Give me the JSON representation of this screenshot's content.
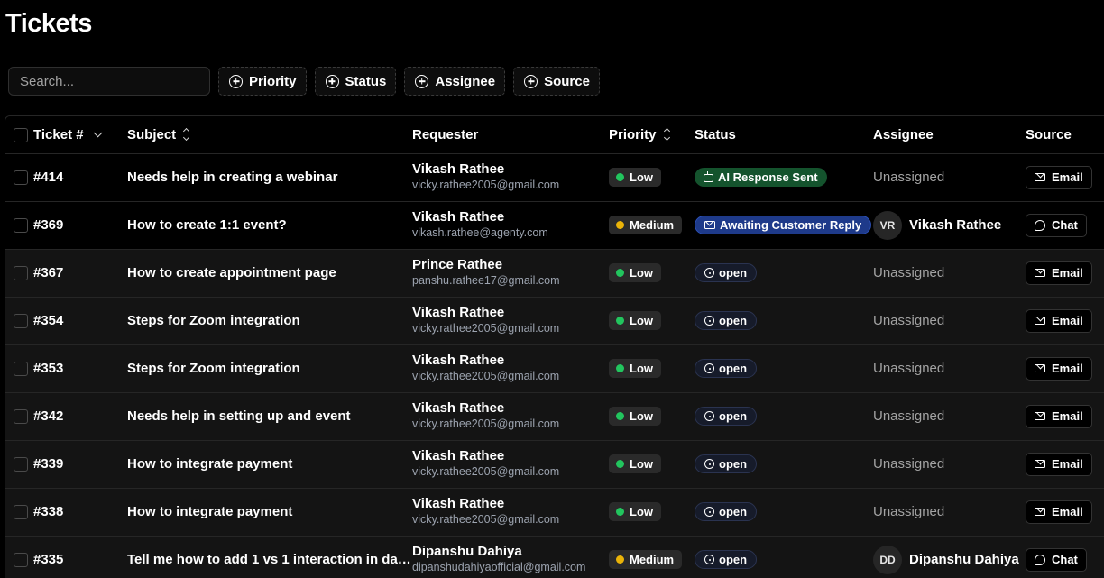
{
  "page": {
    "title": "Tickets"
  },
  "toolbar": {
    "search_placeholder": "Search...",
    "filters": [
      {
        "label": "Priority"
      },
      {
        "label": "Status"
      },
      {
        "label": "Assignee"
      },
      {
        "label": "Source"
      }
    ]
  },
  "table": {
    "headers": {
      "ticket": "Ticket #",
      "subject": "Subject",
      "requester": "Requester",
      "priority": "Priority",
      "status": "Status",
      "assignee": "Assignee",
      "source": "Source"
    },
    "rows": [
      {
        "id": "#414",
        "subject": "Needs help in creating a webinar",
        "requester_name": "Vikash Rathee",
        "requester_email": "vicky.rathee2005@gmail.com",
        "priority": "Low",
        "priority_color": "#22c55e",
        "status": "AI Response Sent",
        "status_kind": "ai",
        "assignee": "Unassigned",
        "assignee_initials": "",
        "source": "Email",
        "source_kind": "email",
        "extra": "S",
        "shade": "dark"
      },
      {
        "id": "#369",
        "subject": "How to create 1:1 event?",
        "requester_name": "Vikash Rathee",
        "requester_email": "vikash.rathee@agenty.com",
        "priority": "Medium",
        "priority_color": "#eab308",
        "status": "Awaiting Customer Reply",
        "status_kind": "await",
        "assignee": "Vikash Rathee",
        "assignee_initials": "VR",
        "source": "Chat",
        "source_kind": "chat",
        "extra": "S",
        "shade": "dark"
      },
      {
        "id": "#367",
        "subject": "How to create appointment page",
        "requester_name": "Prince Rathee",
        "requester_email": "panshu.rathee17@gmail.com",
        "priority": "Low",
        "priority_color": "#22c55e",
        "status": "open",
        "status_kind": "open",
        "assignee": "Unassigned",
        "assignee_initials": "",
        "source": "Email",
        "source_kind": "email",
        "extra": "S",
        "shade": "dim"
      },
      {
        "id": "#354",
        "subject": "Steps for Zoom integration",
        "requester_name": "Vikash Rathee",
        "requester_email": "vicky.rathee2005@gmail.com",
        "priority": "Low",
        "priority_color": "#22c55e",
        "status": "open",
        "status_kind": "open",
        "assignee": "Unassigned",
        "assignee_initials": "",
        "source": "Email",
        "source_kind": "email",
        "extra": "A",
        "shade": "dim"
      },
      {
        "id": "#353",
        "subject": "Steps for Zoom integration",
        "requester_name": "Vikash Rathee",
        "requester_email": "vicky.rathee2005@gmail.com",
        "priority": "Low",
        "priority_color": "#22c55e",
        "status": "open",
        "status_kind": "open",
        "assignee": "Unassigned",
        "assignee_initials": "",
        "source": "Email",
        "source_kind": "email",
        "extra": "A",
        "shade": "dim"
      },
      {
        "id": "#342",
        "subject": "Needs help in setting up and event",
        "requester_name": "Vikash Rathee",
        "requester_email": "vicky.rathee2005@gmail.com",
        "priority": "Low",
        "priority_color": "#22c55e",
        "status": "open",
        "status_kind": "open",
        "assignee": "Unassigned",
        "assignee_initials": "",
        "source": "Email",
        "source_kind": "email",
        "extra": "A",
        "shade": "dim"
      },
      {
        "id": "#339",
        "subject": "How to integrate payment",
        "requester_name": "Vikash Rathee",
        "requester_email": "vicky.rathee2005@gmail.com",
        "priority": "Low",
        "priority_color": "#22c55e",
        "status": "open",
        "status_kind": "open",
        "assignee": "Unassigned",
        "assignee_initials": "",
        "source": "Email",
        "source_kind": "email",
        "extra": "A",
        "shade": "dim"
      },
      {
        "id": "#338",
        "subject": "How to integrate payment",
        "requester_name": "Vikash Rathee",
        "requester_email": "vicky.rathee2005@gmail.com",
        "priority": "Low",
        "priority_color": "#22c55e",
        "status": "open",
        "status_kind": "open",
        "assignee": "Unassigned",
        "assignee_initials": "",
        "source": "Email",
        "source_kind": "email",
        "extra": "A",
        "shade": "dim"
      },
      {
        "id": "#335",
        "subject": "Tell me how to add 1 vs 1 interaction in day...",
        "requester_name": "Dipanshu Dahiya",
        "requester_email": "dipanshudahiyaofficial@gmail.com",
        "priority": "Medium",
        "priority_color": "#eab308",
        "status": "open",
        "status_kind": "open",
        "assignee": "Dipanshu Dahiya",
        "assignee_initials": "DD",
        "source": "Chat",
        "source_kind": "chat",
        "extra": "",
        "shade": "dim"
      }
    ]
  }
}
